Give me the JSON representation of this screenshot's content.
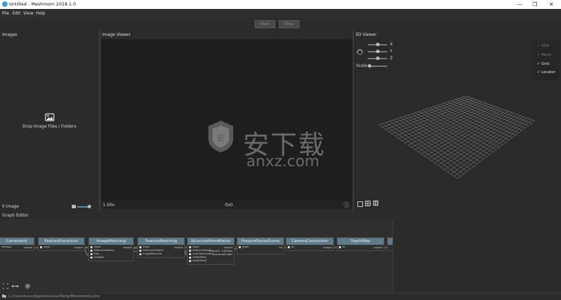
{
  "window": {
    "title": "Untitled - Meshroom 2018.1.0",
    "minimize": "—",
    "maximize": "❐",
    "close": "✕"
  },
  "menu": {
    "file": "File",
    "edit": "Edit",
    "view": "View",
    "help": "Help"
  },
  "toolbar": {
    "start": "Start",
    "stop": "Stop"
  },
  "images_panel": {
    "title": "Images",
    "drop_text": "Drop Image Files / Folders",
    "count": "0 image"
  },
  "image_viewer": {
    "title": "Image Viewer",
    "zoom": "1.00x",
    "resolution": "0x0",
    "info_icon": "ⓘ"
  },
  "viewer3d": {
    "title": "3D Viewer",
    "axis_x": "X",
    "axis_y": "Y",
    "axis_z": "Z",
    "scale": "Scale",
    "overlays": [
      {
        "check": "✓",
        "label": "SFM",
        "enabled": false
      },
      {
        "check": "✓",
        "label": "Mesh",
        "enabled": false
      },
      {
        "check": "✓",
        "label": "Grid",
        "enabled": true
      },
      {
        "check": "✓",
        "label": "Locator",
        "enabled": true
      }
    ]
  },
  "graph": {
    "title": "Graph Editor",
    "nodes": [
      {
        "name": "CameraInit",
        "inputs": [
          "viewpoi"
        ],
        "output": "output"
      },
      {
        "name": "FeatureExtraction",
        "inputs": [
          "input"
        ],
        "output": "output"
      },
      {
        "name": "ImageMatching",
        "inputs": [
          "input",
          "featuresFolders",
          "tree",
          "weights"
        ],
        "output": "output"
      },
      {
        "name": "FeatureMatching",
        "inputs": [
          "input",
          "featuresFolders",
          "imagePairsList"
        ],
        "output": "output"
      },
      {
        "name": "StructureFromMotion",
        "inputs": [
          "input",
          "featuresFolder",
          "matchesFolders",
          "initialPairA",
          "initialPairB"
        ],
        "output": "output"
      },
      {
        "name": "PrepareDenseScene",
        "inputs": [
          "input"
        ],
        "output": "ini"
      },
      {
        "name": "CameraConnection",
        "inputs": [
          "ini"
        ],
        "output": "output"
      },
      {
        "name": "DepthMap",
        "inputs": [
          "ini"
        ],
        "output": "output"
      }
    ],
    "sfm_outputs": [
      "output",
      "outputV...ndPoses",
      "extraInfoFolder"
    ]
  },
  "status": {
    "cache_path": "C:/Users/lunvs/AppData/Local/Temp/MeshroomCache"
  },
  "watermark": {
    "cn": "安下载",
    "url": "anxz.com"
  }
}
